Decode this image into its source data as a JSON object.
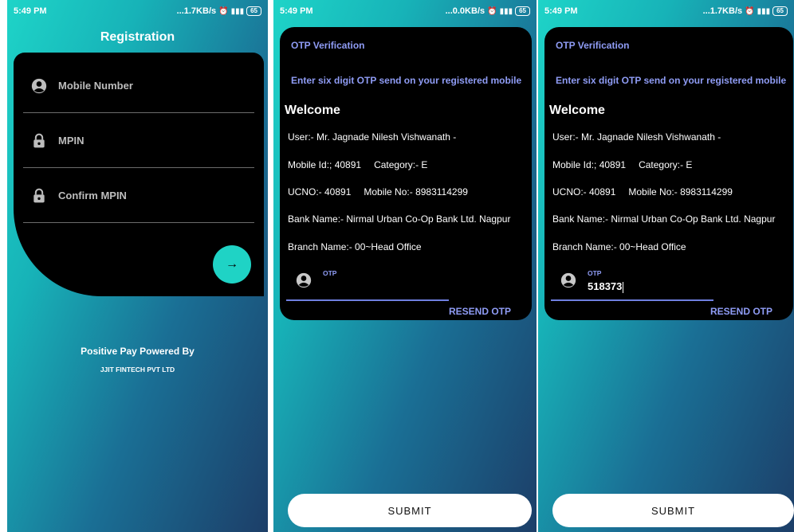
{
  "statusbar": {
    "time": "5:49 PM",
    "network_speed_1": "...1.7KB/s",
    "network_speed_2": "...0.0KB/s",
    "network_speed_3": "...1.7KB/s",
    "battery": "65"
  },
  "registration": {
    "title": "Registration",
    "fields": [
      {
        "label": "Mobile Number",
        "icon": "account-icon"
      },
      {
        "label": "MPIN",
        "icon": "lock-icon"
      },
      {
        "label": "Confirm MPIN",
        "icon": "lock-icon"
      }
    ],
    "next_arrow": "→",
    "powered_by": "Positive Pay Powered By",
    "company": "JJIT FINTECH PVT LTD"
  },
  "otp": {
    "header": "OTP Verification",
    "subtitle": "Enter six digit OTP send on your registered mobile",
    "welcome": "Welcome",
    "user": "User:- Mr.  Jagnade Nilesh Vishwanath -",
    "mobile_id": "Mobile Id:; 40891",
    "category": "Category:- E",
    "ucno": "UCNO:- 40891",
    "mobile_no": "Mobile No:- 8983114299",
    "bank": "Bank Name:- Nirmal Urban Co-Op Bank Ltd. Nagpur",
    "branch": "Branch Name:- 00~Head Office",
    "otp_label": "OTP",
    "otp_value_empty": "",
    "otp_value_filled": "518373",
    "resend": "RESEND OTP",
    "submit": "SUBMIT"
  },
  "colors": {
    "accent_teal": "#1fd3c5",
    "label_blue": "#8f9cf5",
    "card_black": "#000000"
  }
}
